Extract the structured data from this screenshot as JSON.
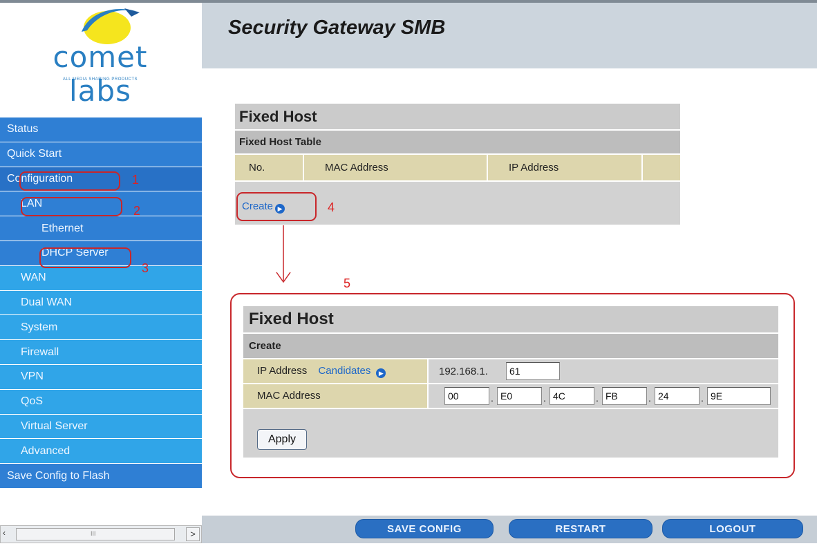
{
  "header": {
    "title": "Security Gateway SMB",
    "logo_text": "comet labs",
    "logo_subtext": "ALL MEDIA SHARING PRODUCTS"
  },
  "sidebar": {
    "items": [
      {
        "label": "Status"
      },
      {
        "label": "Quick Start"
      },
      {
        "label": "Configuration"
      },
      {
        "label": "LAN"
      },
      {
        "label": "Ethernet"
      },
      {
        "label": "DHCP Server"
      },
      {
        "label": "WAN"
      },
      {
        "label": "Dual WAN"
      },
      {
        "label": "System"
      },
      {
        "label": "Firewall"
      },
      {
        "label": "VPN"
      },
      {
        "label": "QoS"
      },
      {
        "label": "Virtual Server"
      },
      {
        "label": "Advanced"
      },
      {
        "label": "Save Config to Flash"
      }
    ]
  },
  "annotations": {
    "n1": "1",
    "n2": "2",
    "n3": "3",
    "n4": "4",
    "n5": "5"
  },
  "fixed_host_table": {
    "title": "Fixed Host",
    "subtitle": "Fixed Host Table",
    "columns": [
      "No.",
      "MAC Address",
      "IP Address"
    ],
    "create_label": "Create"
  },
  "fixed_host_create": {
    "title": "Fixed Host",
    "subtitle": "Create",
    "ip_label": "IP Address",
    "candidates_label": "Candidates",
    "ip_prefix": "192.168.1.",
    "ip_last_octet": "61",
    "mac_label": "MAC Address",
    "mac_octets": [
      "00",
      "E0",
      "4C",
      "FB",
      "24",
      "9E"
    ],
    "mac_sep": ".",
    "apply_label": "Apply"
  },
  "bottom_buttons": {
    "save": "SAVE CONFIG",
    "restart": "RESTART",
    "logout": "LOGOUT"
  },
  "scrollbar": {
    "grip": "III"
  },
  "colors": {
    "nav_dark": "#2f7fd4",
    "nav_light": "#30a5e8",
    "annotation_red": "#c8262a",
    "header_bg": "#ccd5dd",
    "row_tan": "#ddd6ad"
  }
}
